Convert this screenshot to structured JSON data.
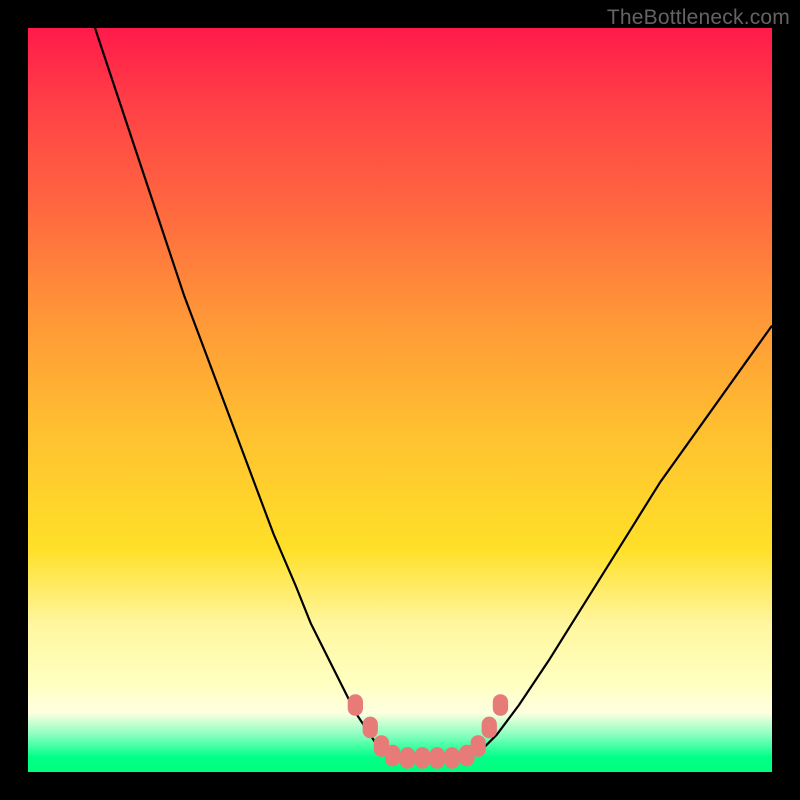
{
  "attribution": "TheBottleneck.com",
  "colors": {
    "frame": "#000000",
    "curve_stroke": "#000000",
    "marker_fill": "#e77b77",
    "marker_stroke": "#d86a66"
  },
  "chart_data": {
    "type": "line",
    "title": "",
    "xlabel": "",
    "ylabel": "",
    "xlim": [
      0,
      100
    ],
    "ylim": [
      0,
      100
    ],
    "grid": false,
    "legend": false,
    "series": [
      {
        "name": "left-branch",
        "x": [
          9,
          12,
          15,
          18,
          21,
          24,
          27,
          30,
          33,
          36,
          38,
          40,
          42,
          44,
          46,
          47,
          48,
          49
        ],
        "values": [
          100,
          91,
          82,
          73,
          64,
          56,
          48,
          40,
          32,
          25,
          20,
          16,
          12,
          8,
          5,
          3.5,
          2.5,
          2
        ]
      },
      {
        "name": "valley-floor",
        "x": [
          49,
          51,
          53,
          55,
          57,
          59
        ],
        "values": [
          2,
          1.8,
          1.8,
          1.8,
          1.8,
          2
        ]
      },
      {
        "name": "right-branch",
        "x": [
          59,
          61,
          63,
          66,
          70,
          75,
          80,
          85,
          90,
          95,
          100
        ],
        "values": [
          2,
          3,
          5,
          9,
          15,
          23,
          31,
          39,
          46,
          53,
          60
        ]
      }
    ],
    "markers": {
      "name": "highlight-points",
      "points": [
        {
          "x": 44,
          "y": 9
        },
        {
          "x": 46,
          "y": 6
        },
        {
          "x": 47.5,
          "y": 3.5
        },
        {
          "x": 49,
          "y": 2.2
        },
        {
          "x": 51,
          "y": 1.9
        },
        {
          "x": 53,
          "y": 1.9
        },
        {
          "x": 55,
          "y": 1.9
        },
        {
          "x": 57,
          "y": 1.9
        },
        {
          "x": 59,
          "y": 2.2
        },
        {
          "x": 60.5,
          "y": 3.5
        },
        {
          "x": 62,
          "y": 6
        },
        {
          "x": 63.5,
          "y": 9
        }
      ],
      "radius": 9
    }
  }
}
